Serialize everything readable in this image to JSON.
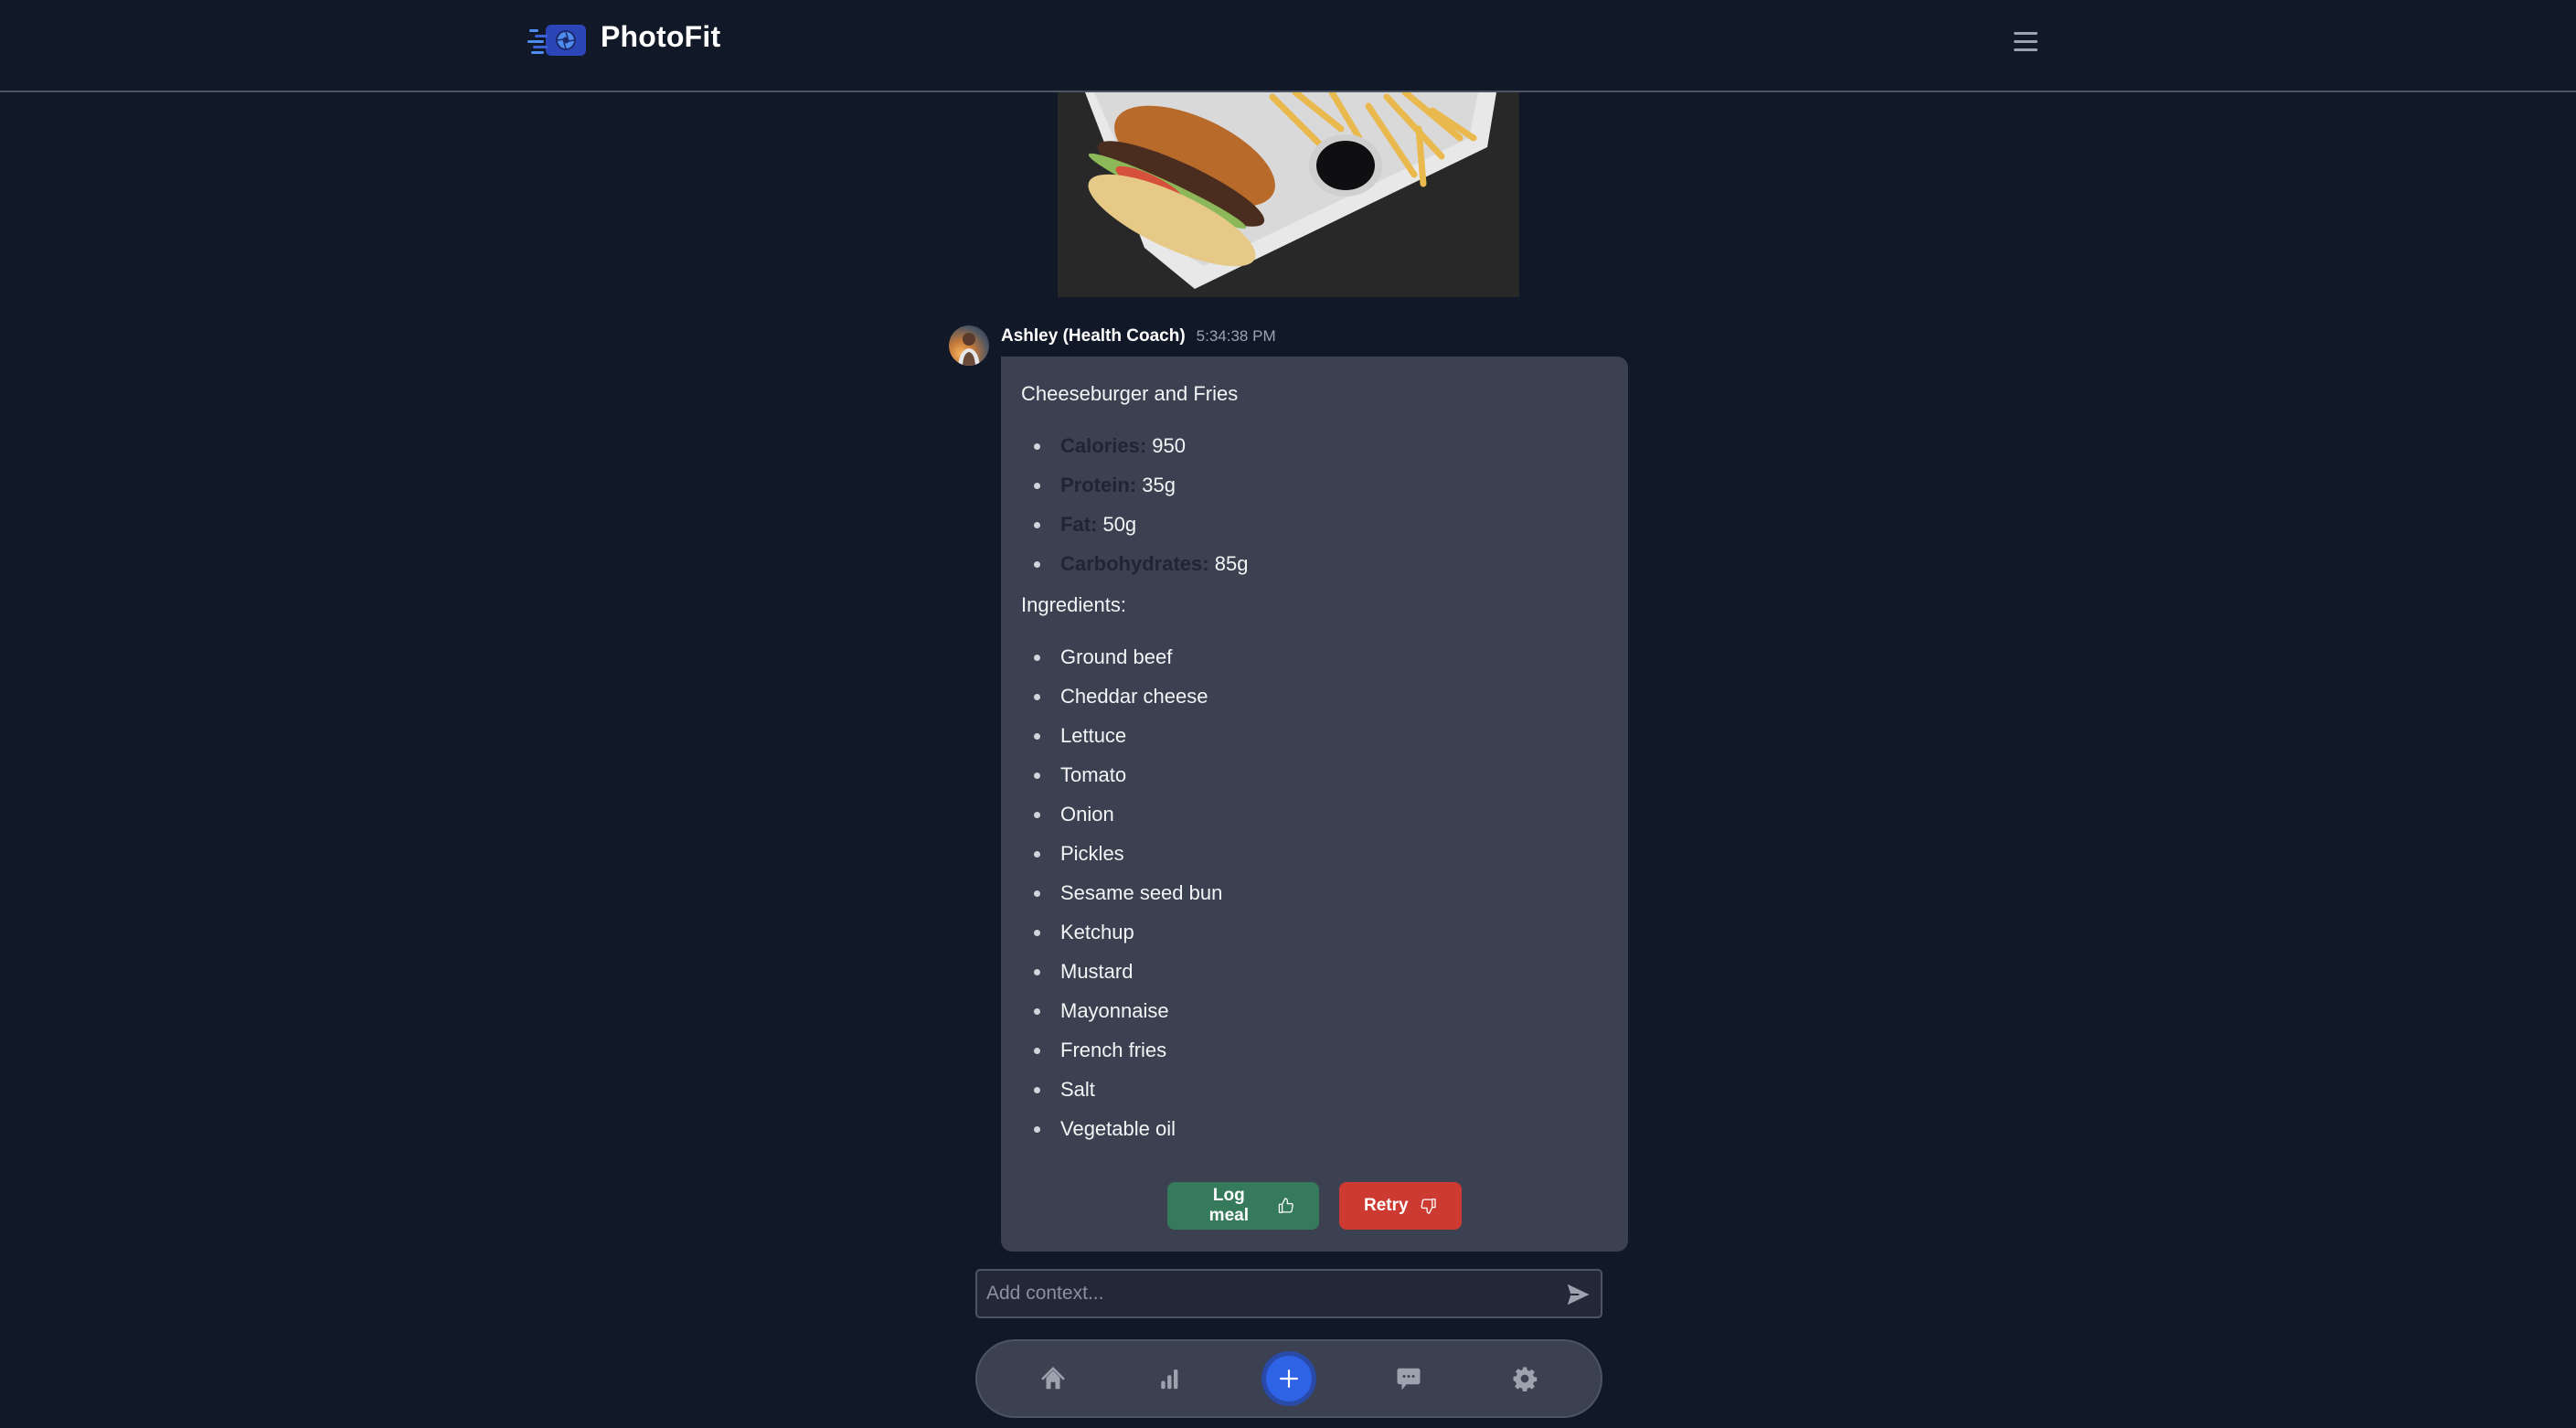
{
  "app": {
    "name": "PhotoFit",
    "logo_icon": "camera-shutter-speed-icon",
    "menu_icon": "hamburger-menu-icon"
  },
  "colors": {
    "background": "#111827",
    "bubble": "#3b4150",
    "accent": "#2f63e6",
    "log_button": "#357a5a",
    "retry_button": "#cc3a31",
    "muted_text": "#9ca3af"
  },
  "photo": {
    "alt": "Cheeseburger with fries and dipping sauce in a takeout box"
  },
  "message": {
    "author": "Ashley (Health Coach)",
    "time": "5:34:38 PM",
    "meal_title": "Cheeseburger and Fries",
    "nutrition": [
      {
        "label": "Calories:",
        "value": "950"
      },
      {
        "label": "Protein:",
        "value": "35g"
      },
      {
        "label": "Fat:",
        "value": "50g"
      },
      {
        "label": "Carbohydrates:",
        "value": "85g"
      }
    ],
    "ingredients_heading": "Ingredients:",
    "ingredients": [
      "Ground beef",
      "Cheddar cheese",
      "Lettuce",
      "Tomato",
      "Onion",
      "Pickles",
      "Sesame seed bun",
      "Ketchup",
      "Mustard",
      "Mayonnaise",
      "French fries",
      "Salt",
      "Vegetable oil"
    ],
    "actions": {
      "log_label": "Log meal",
      "log_icon": "thumbs-up-icon",
      "retry_label": "Retry",
      "retry_icon": "thumbs-down-icon"
    }
  },
  "composer": {
    "placeholder": "Add context...",
    "value": "",
    "send_icon": "send-icon"
  },
  "bottom_nav": {
    "items": [
      {
        "name": "home",
        "icon": "home-icon"
      },
      {
        "name": "stats",
        "icon": "bar-chart-icon"
      },
      {
        "name": "add",
        "icon": "plus-icon"
      },
      {
        "name": "chat",
        "icon": "chat-bubble-icon"
      },
      {
        "name": "settings",
        "icon": "gear-icon"
      }
    ]
  }
}
